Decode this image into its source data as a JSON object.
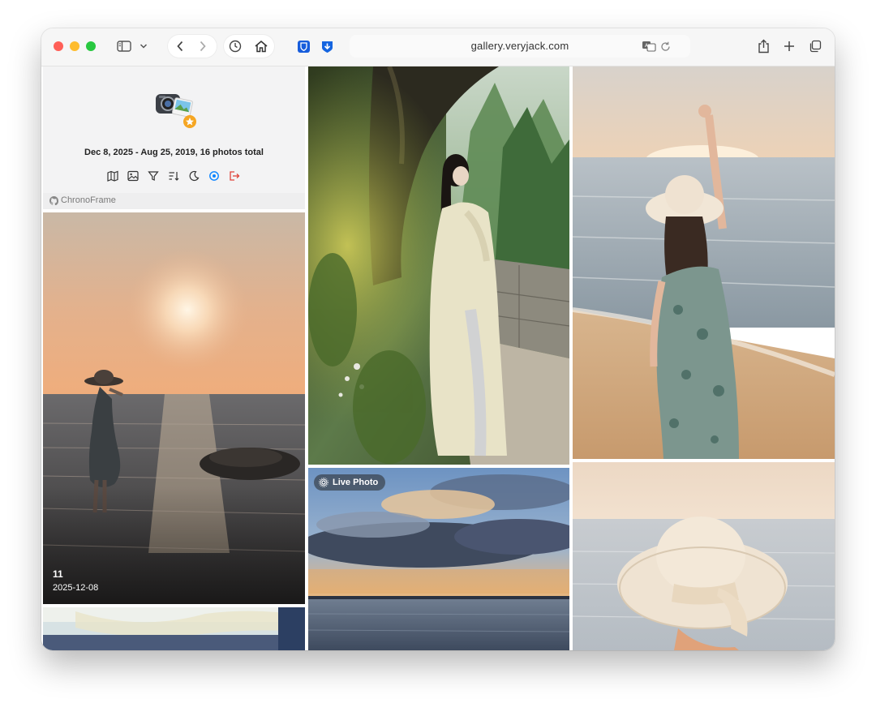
{
  "browser": {
    "url": "gallery.veryjack.com"
  },
  "gallery": {
    "summary": "Dec 8, 2025 - Aug 25, 2019, 16 photos total",
    "project_label": "ChronoFrame",
    "tools": [
      "map-icon",
      "image-icon",
      "filter-icon",
      "sort-icon",
      "moon-icon",
      "circle-dot-icon",
      "logout-icon"
    ]
  },
  "photos": {
    "sunset_sea": {
      "index": "11",
      "date": "2025-12-08"
    },
    "clouds": {
      "badge": "Live Photo"
    }
  },
  "colors": {
    "accent": "#0a84ff",
    "logout": "#e0443a",
    "star_badge": "#f5a623"
  }
}
